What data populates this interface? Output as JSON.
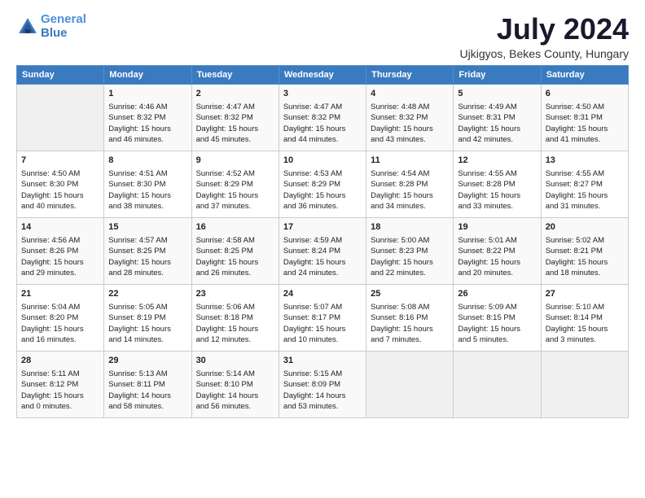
{
  "logo": {
    "line1": "General",
    "line2": "Blue"
  },
  "title": "July 2024",
  "subtitle": "Ujkigyos, Bekes County, Hungary",
  "header_days": [
    "Sunday",
    "Monday",
    "Tuesday",
    "Wednesday",
    "Thursday",
    "Friday",
    "Saturday"
  ],
  "weeks": [
    [
      {
        "day": "",
        "info": ""
      },
      {
        "day": "1",
        "info": "Sunrise: 4:46 AM\nSunset: 8:32 PM\nDaylight: 15 hours\nand 46 minutes."
      },
      {
        "day": "2",
        "info": "Sunrise: 4:47 AM\nSunset: 8:32 PM\nDaylight: 15 hours\nand 45 minutes."
      },
      {
        "day": "3",
        "info": "Sunrise: 4:47 AM\nSunset: 8:32 PM\nDaylight: 15 hours\nand 44 minutes."
      },
      {
        "day": "4",
        "info": "Sunrise: 4:48 AM\nSunset: 8:32 PM\nDaylight: 15 hours\nand 43 minutes."
      },
      {
        "day": "5",
        "info": "Sunrise: 4:49 AM\nSunset: 8:31 PM\nDaylight: 15 hours\nand 42 minutes."
      },
      {
        "day": "6",
        "info": "Sunrise: 4:50 AM\nSunset: 8:31 PM\nDaylight: 15 hours\nand 41 minutes."
      }
    ],
    [
      {
        "day": "7",
        "info": "Sunrise: 4:50 AM\nSunset: 8:30 PM\nDaylight: 15 hours\nand 40 minutes."
      },
      {
        "day": "8",
        "info": "Sunrise: 4:51 AM\nSunset: 8:30 PM\nDaylight: 15 hours\nand 38 minutes."
      },
      {
        "day": "9",
        "info": "Sunrise: 4:52 AM\nSunset: 8:29 PM\nDaylight: 15 hours\nand 37 minutes."
      },
      {
        "day": "10",
        "info": "Sunrise: 4:53 AM\nSunset: 8:29 PM\nDaylight: 15 hours\nand 36 minutes."
      },
      {
        "day": "11",
        "info": "Sunrise: 4:54 AM\nSunset: 8:28 PM\nDaylight: 15 hours\nand 34 minutes."
      },
      {
        "day": "12",
        "info": "Sunrise: 4:55 AM\nSunset: 8:28 PM\nDaylight: 15 hours\nand 33 minutes."
      },
      {
        "day": "13",
        "info": "Sunrise: 4:55 AM\nSunset: 8:27 PM\nDaylight: 15 hours\nand 31 minutes."
      }
    ],
    [
      {
        "day": "14",
        "info": "Sunrise: 4:56 AM\nSunset: 8:26 PM\nDaylight: 15 hours\nand 29 minutes."
      },
      {
        "day": "15",
        "info": "Sunrise: 4:57 AM\nSunset: 8:25 PM\nDaylight: 15 hours\nand 28 minutes."
      },
      {
        "day": "16",
        "info": "Sunrise: 4:58 AM\nSunset: 8:25 PM\nDaylight: 15 hours\nand 26 minutes."
      },
      {
        "day": "17",
        "info": "Sunrise: 4:59 AM\nSunset: 8:24 PM\nDaylight: 15 hours\nand 24 minutes."
      },
      {
        "day": "18",
        "info": "Sunrise: 5:00 AM\nSunset: 8:23 PM\nDaylight: 15 hours\nand 22 minutes."
      },
      {
        "day": "19",
        "info": "Sunrise: 5:01 AM\nSunset: 8:22 PM\nDaylight: 15 hours\nand 20 minutes."
      },
      {
        "day": "20",
        "info": "Sunrise: 5:02 AM\nSunset: 8:21 PM\nDaylight: 15 hours\nand 18 minutes."
      }
    ],
    [
      {
        "day": "21",
        "info": "Sunrise: 5:04 AM\nSunset: 8:20 PM\nDaylight: 15 hours\nand 16 minutes."
      },
      {
        "day": "22",
        "info": "Sunrise: 5:05 AM\nSunset: 8:19 PM\nDaylight: 15 hours\nand 14 minutes."
      },
      {
        "day": "23",
        "info": "Sunrise: 5:06 AM\nSunset: 8:18 PM\nDaylight: 15 hours\nand 12 minutes."
      },
      {
        "day": "24",
        "info": "Sunrise: 5:07 AM\nSunset: 8:17 PM\nDaylight: 15 hours\nand 10 minutes."
      },
      {
        "day": "25",
        "info": "Sunrise: 5:08 AM\nSunset: 8:16 PM\nDaylight: 15 hours\nand 7 minutes."
      },
      {
        "day": "26",
        "info": "Sunrise: 5:09 AM\nSunset: 8:15 PM\nDaylight: 15 hours\nand 5 minutes."
      },
      {
        "day": "27",
        "info": "Sunrise: 5:10 AM\nSunset: 8:14 PM\nDaylight: 15 hours\nand 3 minutes."
      }
    ],
    [
      {
        "day": "28",
        "info": "Sunrise: 5:11 AM\nSunset: 8:12 PM\nDaylight: 15 hours\nand 0 minutes."
      },
      {
        "day": "29",
        "info": "Sunrise: 5:13 AM\nSunset: 8:11 PM\nDaylight: 14 hours\nand 58 minutes."
      },
      {
        "day": "30",
        "info": "Sunrise: 5:14 AM\nSunset: 8:10 PM\nDaylight: 14 hours\nand 56 minutes."
      },
      {
        "day": "31",
        "info": "Sunrise: 5:15 AM\nSunset: 8:09 PM\nDaylight: 14 hours\nand 53 minutes."
      },
      {
        "day": "",
        "info": ""
      },
      {
        "day": "",
        "info": ""
      },
      {
        "day": "",
        "info": ""
      }
    ]
  ]
}
